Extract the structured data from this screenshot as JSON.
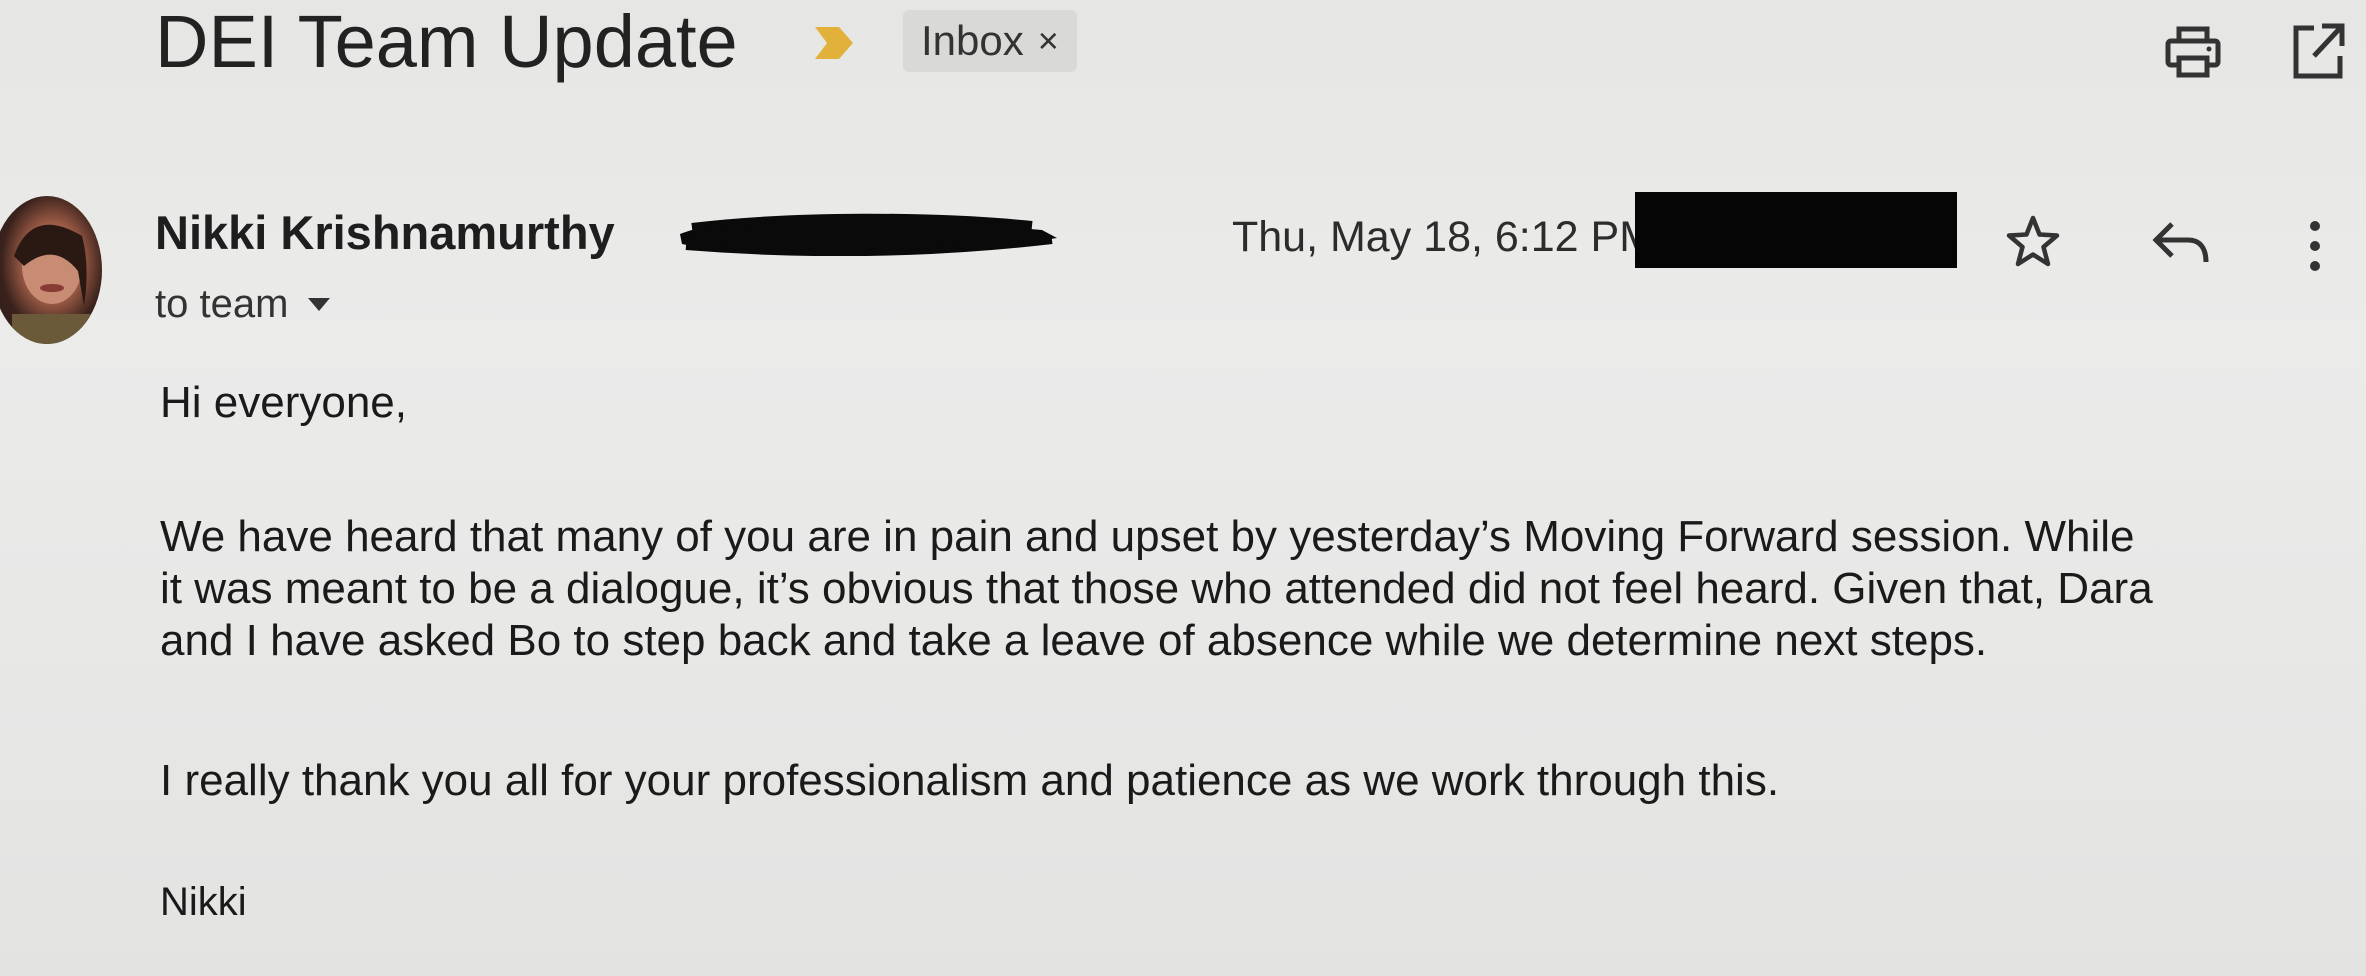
{
  "header": {
    "subject": "DEI Team Update",
    "label": "Inbox",
    "label_close": "×",
    "icons": [
      "importance-marker-icon",
      "print-icon",
      "open-new-window-icon"
    ]
  },
  "sender": {
    "name": "Nikki Krishnamurthy",
    "date": "Thu, May 18, 6:12 PM",
    "recipient": "to team",
    "icons": [
      "star-icon",
      "reply-icon",
      "more-vert-icon",
      "dropdown-caret-icon"
    ]
  },
  "body": {
    "greeting": "Hi everyone,",
    "paragraph1_lines": [
      "We have heard that many of you are in pain and upset by yesterday’s Moving Forward session. While",
      "it was meant to be a dialogue, it’s obvious that those who attended did not feel heard. Given that, Dara",
      "and I have asked Bo to step back and take a leave of absence while we determine next steps."
    ],
    "paragraph2": "I really thank you all for your professionalism and patience as we work through this.",
    "signature": "Nikki"
  },
  "colors": {
    "background": "#e8e8e7",
    "text": "#1a1a1a",
    "importance": "#e2b13c",
    "chip": "#d9d9d7",
    "redaction": "#050505"
  }
}
